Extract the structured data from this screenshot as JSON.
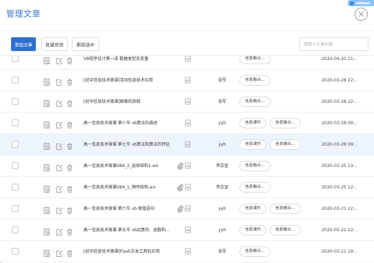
{
  "header": {
    "title": "管理文章"
  },
  "toolbar": {
    "add_label": "添加文章",
    "batch_edit_label": "批量修改",
    "delete_selected_label": "删除选中",
    "search_placeholder": "请输入文章标题"
  },
  "rows": [
    {
      "title": "VB程序设计第一讲 数据类型及变量",
      "author": "",
      "tags": [
        "信息融合..."
      ],
      "date": "2020-04-20 21:..",
      "attachment": false,
      "highlight": false
    },
    {
      "title": "[初中信息技术微课]活动信息技术应用",
      "author": "张军",
      "tags": [
        "信息融合..."
      ],
      "date": "2020-03-28 22:..",
      "attachment": false,
      "highlight": false
    },
    {
      "title": "[初中信息技术微课]图像的获取",
      "author": "张军",
      "tags": [
        "信息融合..."
      ],
      "date": "2020-03-28 22:..",
      "attachment": false,
      "highlight": false
    },
    {
      "title": "高一信息技术微课 第八节 vb算法的描述",
      "author": "yyh",
      "tags": [
        "信息课件",
        "信息融合..."
      ],
      "date": "2020-03-28 09:..",
      "attachment": false,
      "highlight": false
    },
    {
      "title": "高一信息技术微课 第七节 vb算法和算法的特征",
      "author": "yyh",
      "tags": [
        "信息课件",
        "信息融合..."
      ],
      "date": "2020-03-28 09:..",
      "attachment": false,
      "highlight": true
    },
    {
      "title": "高一信息技术微课VB4_2_选择结构1.avi",
      "author": "李志宣",
      "tags": [
        "信息融合..."
      ],
      "date": "2020-03-25 13:..",
      "attachment": true,
      "highlight": false
    },
    {
      "title": "高一信息技术微课VB4_1_顺序结构.avi",
      "author": "李志宣",
      "tags": [
        "信息融合..."
      ],
      "date": "2020-03-25 12:..",
      "attachment": true,
      "highlight": false
    },
    {
      "title": "高一信息技术微课 第六节 vb 赋值语句",
      "author": "yyh",
      "tags": [
        "信息课件",
        "信息融合..."
      ],
      "date": "2020-03-21 22:..",
      "attachment": true,
      "highlight": false
    },
    {
      "title": "高一信息技术微课 第五节 vb运算符、函数和...",
      "author": "yyh",
      "tags": [
        "信息课件",
        "信息融合..."
      ],
      "date": "2020-03-21 22:..",
      "attachment": false,
      "highlight": false
    },
    {
      "title": "[初中信息技术微课]Flash文本工具的应用",
      "author": "张军",
      "tags": [
        "信息融合..."
      ],
      "date": "2020-03-21 19:..",
      "attachment": false,
      "highlight": false
    }
  ]
}
